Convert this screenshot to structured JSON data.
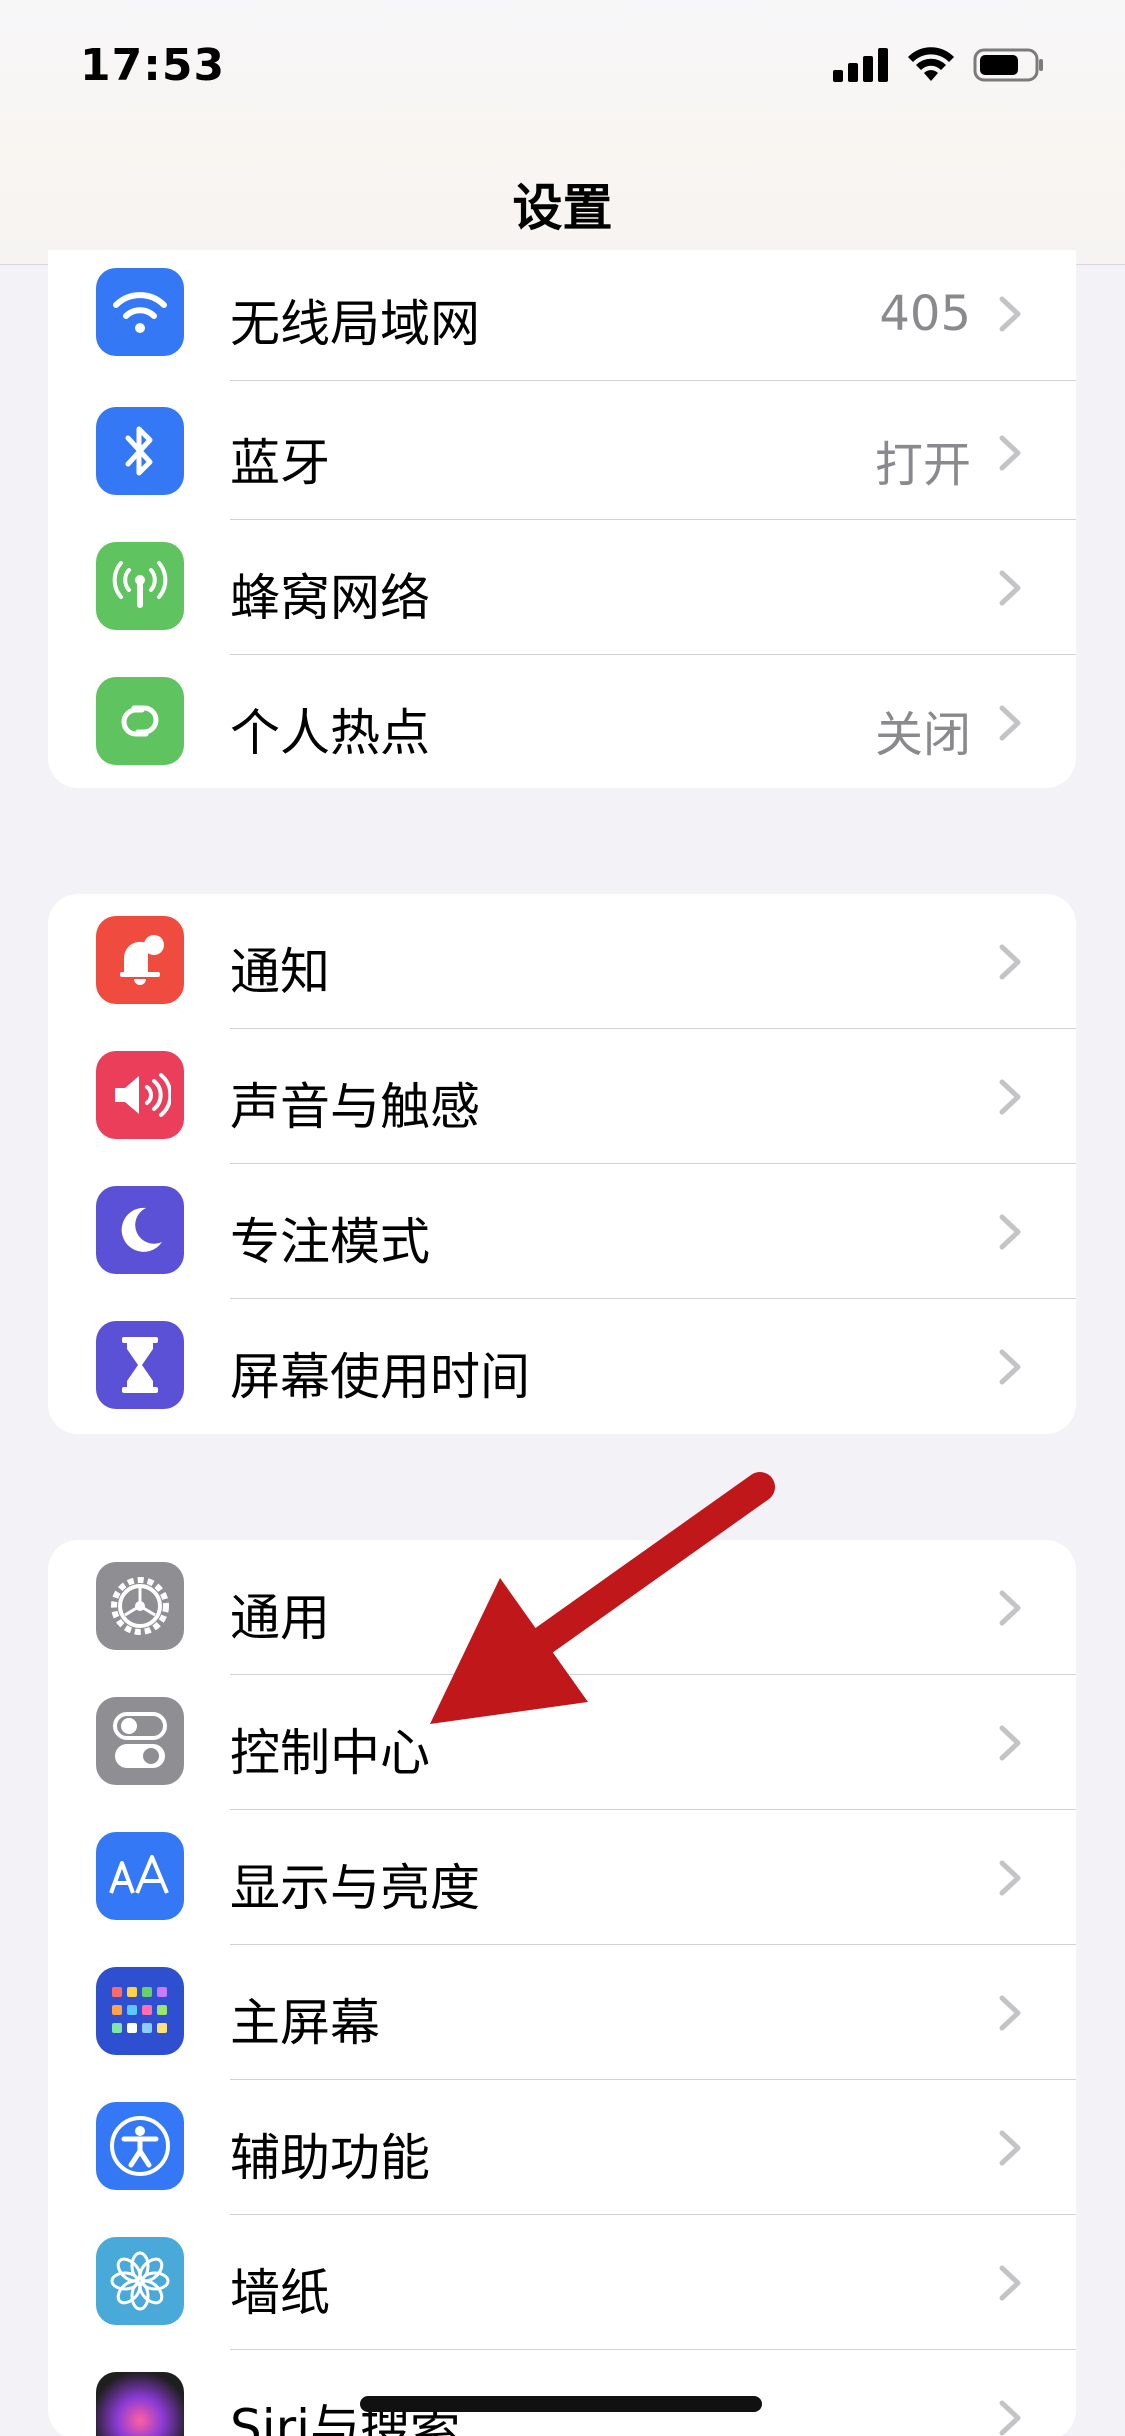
{
  "status_bar": {
    "time": "17:53"
  },
  "nav": {
    "title": "设置"
  },
  "groups": [
    {
      "items": [
        {
          "label": "无线局域网",
          "value": "405",
          "icon": "wifi-icon",
          "color": "#3478f6"
        },
        {
          "label": "蓝牙",
          "value": "打开",
          "icon": "bluetooth-icon",
          "color": "#3478f6"
        },
        {
          "label": "蜂窝网络",
          "value": "",
          "icon": "cellular-icon",
          "color": "#5fc45f"
        },
        {
          "label": "个人热点",
          "value": "关闭",
          "icon": "hotspot-icon",
          "color": "#5fc45f"
        }
      ]
    },
    {
      "items": [
        {
          "label": "通知",
          "value": "",
          "icon": "notifications-icon",
          "color": "#ef4b3f"
        },
        {
          "label": "声音与触感",
          "value": "",
          "icon": "sound-icon",
          "color": "#ea3e5b"
        },
        {
          "label": "专注模式",
          "value": "",
          "icon": "focus-moon-icon",
          "color": "#5b51d6"
        },
        {
          "label": "屏幕使用时间",
          "value": "",
          "icon": "hourglass-icon",
          "color": "#5b51d6"
        }
      ]
    },
    {
      "items": [
        {
          "label": "通用",
          "value": "",
          "icon": "gear-icon",
          "color": "#8e8e93"
        },
        {
          "label": "控制中心",
          "value": "",
          "icon": "toggles-icon",
          "color": "#8e8e93"
        },
        {
          "label": "显示与亮度",
          "value": "",
          "icon": "display-aa-icon",
          "color": "#3478f6"
        },
        {
          "label": "主屏幕",
          "value": "",
          "icon": "home-screen-icon",
          "color": "#2d4fd0"
        },
        {
          "label": "辅助功能",
          "value": "",
          "icon": "accessibility-icon",
          "color": "#3478f6"
        },
        {
          "label": "墙纸",
          "value": "",
          "icon": "wallpaper-flower-icon",
          "color": "#49a9d9"
        },
        {
          "label": "Siri与搜索",
          "value": "",
          "icon": "siri-icon",
          "color": "#222222"
        }
      ]
    }
  ],
  "annotation": {
    "arrow_color": "#c0171b"
  }
}
